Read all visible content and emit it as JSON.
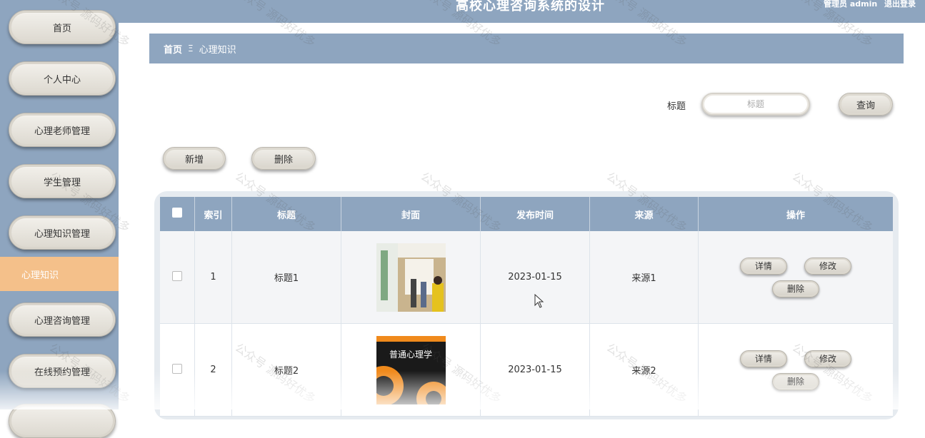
{
  "header": {
    "title": "高校心理咨询系统的设计",
    "admin": "管理员 admin",
    "logout": "退出登录"
  },
  "sidebar": {
    "items": [
      {
        "label": "首页"
      },
      {
        "label": "个人中心"
      },
      {
        "label": "心理老师管理"
      },
      {
        "label": "学生管理"
      },
      {
        "label": "心理知识管理"
      },
      {
        "label": "心理知识"
      },
      {
        "label": "心理咨询管理"
      },
      {
        "label": "在线预约管理"
      }
    ]
  },
  "breadcrumb": {
    "home": "首页",
    "separator": "Ξ",
    "current": "心理知识"
  },
  "search": {
    "label": "标题",
    "placeholder": "标题",
    "button": "查询"
  },
  "actions": {
    "add": "新增",
    "delete": "删除"
  },
  "table": {
    "headers": [
      "索引",
      "标题",
      "封面",
      "发布时间",
      "来源",
      "操作"
    ],
    "rows": [
      {
        "index": "1",
        "title": "标题1",
        "date": "2023-01-15",
        "source": "来源1",
        "cover_text": ""
      },
      {
        "index": "2",
        "title": "标题2",
        "date": "2023-01-15",
        "source": "来源2",
        "cover_text": "普通心理学"
      }
    ],
    "ops": {
      "detail": "详情",
      "edit": "修改",
      "delete": "删除"
    }
  },
  "watermark": "公众号 源码好优多",
  "colors": {
    "primary": "#8ea5bf",
    "active": "#f4c08a"
  }
}
